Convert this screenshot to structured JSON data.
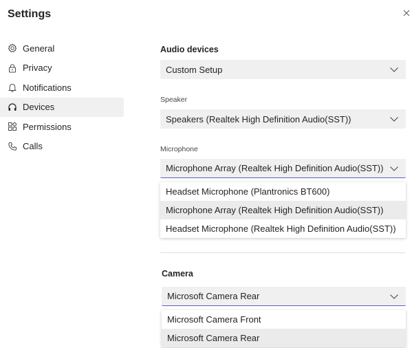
{
  "window": {
    "title": "Settings"
  },
  "sidebar": {
    "items": [
      {
        "label": "General",
        "icon": "gear-icon"
      },
      {
        "label": "Privacy",
        "icon": "lock-icon"
      },
      {
        "label": "Notifications",
        "icon": "bell-icon"
      },
      {
        "label": "Devices",
        "icon": "headset-icon",
        "active": true
      },
      {
        "label": "Permissions",
        "icon": "apps-icon"
      },
      {
        "label": "Calls",
        "icon": "phone-icon"
      }
    ]
  },
  "audio": {
    "title": "Audio devices",
    "selected": "Custom Setup"
  },
  "speaker": {
    "label": "Speaker",
    "selected": "Speakers (Realtek High Definition Audio(SST))"
  },
  "microphone": {
    "label": "Microphone",
    "selected": "Microphone Array (Realtek High Definition Audio(SST))",
    "options": [
      "Headset Microphone (Plantronics BT600)",
      "Microphone Array (Realtek High Definition Audio(SST))",
      "Headset Microphone (Realtek High Definition Audio(SST))"
    ]
  },
  "camera": {
    "title": "Camera",
    "selected": "Microsoft Camera Rear",
    "options": [
      "Microsoft Camera Front",
      "Microsoft Camera Rear"
    ]
  },
  "colors": {
    "accent": "#5b5fc7",
    "select_bg": "#f0f0f0",
    "text": "#252423"
  }
}
